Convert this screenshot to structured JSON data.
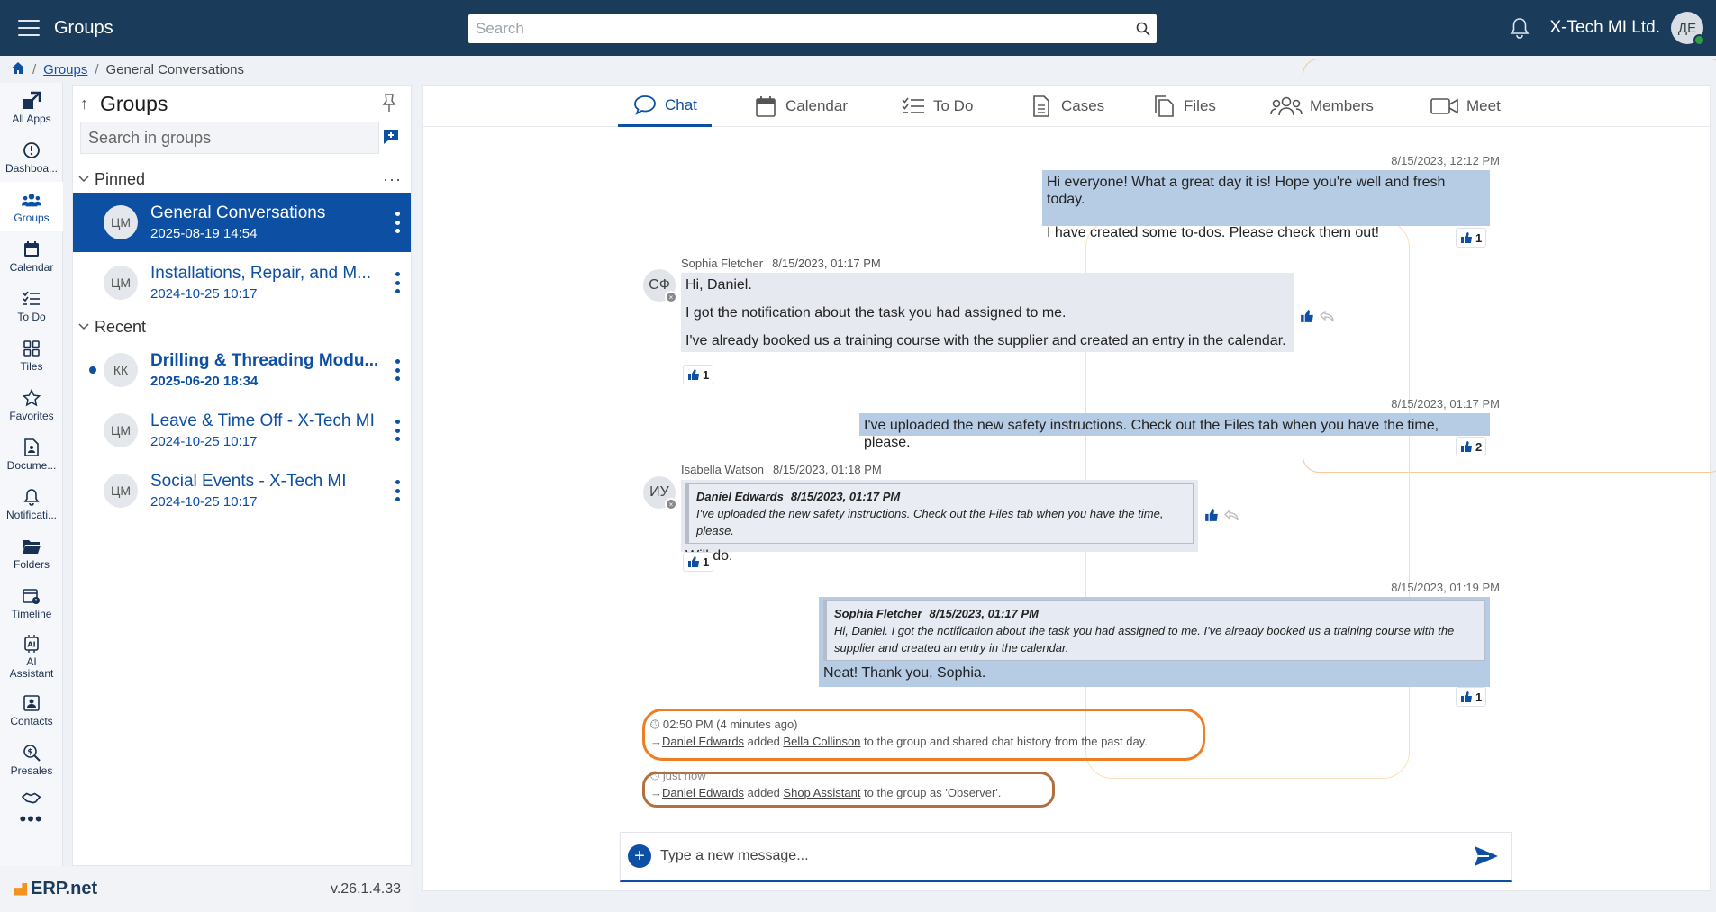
{
  "topbar": {
    "title": "Groups",
    "search_placeholder": "Search",
    "company": "X-Tech MI Ltd.",
    "avatar_initials": "ДЕ"
  },
  "breadcrumb": {
    "home": "home",
    "groups": "Groups",
    "current": "General Conversations"
  },
  "rail": [
    {
      "label": "All Apps",
      "icon": "all-apps-icon"
    },
    {
      "label": "Dashboa...",
      "icon": "dashboard-icon"
    },
    {
      "label": "Groups",
      "icon": "groups-icon"
    },
    {
      "label": "Calendar",
      "icon": "calendar-icon"
    },
    {
      "label": "To Do",
      "icon": "todo-icon"
    },
    {
      "label": "Tiles",
      "icon": "tiles-icon"
    },
    {
      "label": "Favorites",
      "icon": "star-icon"
    },
    {
      "label": "Docume...",
      "icon": "document-icon"
    },
    {
      "label": "Notificati...",
      "icon": "bell-icon"
    },
    {
      "label": "Folders",
      "icon": "folder-icon"
    },
    {
      "label": "Timeline",
      "icon": "timeline-icon"
    },
    {
      "label": "AI Assistant",
      "icon": "ai-icon"
    },
    {
      "label": "Contacts",
      "icon": "contacts-icon"
    },
    {
      "label": "Presales",
      "icon": "presales-icon"
    },
    {
      "label": "",
      "icon": "handshake-icon"
    }
  ],
  "groups_panel": {
    "title": "Groups",
    "search_placeholder": "Search in groups",
    "pinned_label": "Pinned",
    "recent_label": "Recent",
    "more": "···",
    "pinned": [
      {
        "name": "General Conversations",
        "date": "2025-08-19 14:54",
        "initials": "ЦМ"
      },
      {
        "name": "Installations, Repair, and M...",
        "date": "2024-10-25 10:17",
        "initials": "ЦМ"
      }
    ],
    "recent": [
      {
        "name": "Drilling & Threading Modu...",
        "date": "2025-06-20 18:34",
        "initials": "КК"
      },
      {
        "name": "Leave & Time Off - X-Tech MI",
        "date": "2024-10-25 10:17",
        "initials": "ЦМ"
      },
      {
        "name": "Social Events - X-Tech MI",
        "date": "2024-10-25 10:17",
        "initials": "ЦМ"
      }
    ]
  },
  "footer": {
    "logo": "ERP.net",
    "version": "v.26.1.4.33"
  },
  "tabs": [
    "Chat",
    "Calendar",
    "To Do",
    "Cases",
    "Files",
    "Members",
    "Meet"
  ],
  "messages": {
    "m1": {
      "time": "8/15/2023, 12:12 PM",
      "p1": "Hi everyone! What a great day it is! Hope you're well and fresh today.",
      "p2": "I have created some to-dos. Please check them out!",
      "reaction": "1"
    },
    "m2": {
      "sender": "Sophia Fletcher",
      "time": "8/15/2023, 01:17 PM",
      "initials": "СФ",
      "p1": "Hi, Daniel.",
      "p2": "I got the notification about the task you had assigned to me.",
      "p3": "I've already booked us a training course with the supplier and created an entry in the calendar.",
      "reaction": "1"
    },
    "m3": {
      "time": "8/15/2023, 01:17 PM",
      "p1": "I've uploaded the new safety instructions. Check out the Files tab when you have the time, please.",
      "reaction": "2"
    },
    "m4": {
      "sender": "Isabella Watson",
      "time": "8/15/2023, 01:18 PM",
      "initials": "ИУ",
      "quote_author": "Daniel Edwards",
      "quote_time": "8/15/2023, 01:17 PM",
      "quote_text": "I've uploaded the new safety instructions. Check out the Files tab when you have the time, please.",
      "text": "Will do.",
      "reaction": "1"
    },
    "m5": {
      "time": "8/15/2023, 01:19 PM",
      "quote_author": "Sophia Fletcher",
      "quote_time": "8/15/2023, 01:17 PM",
      "quote_text": "Hi, Daniel. I got the notification about the task you had assigned to me. I've already booked us a training course with the supplier and created an entry in the calendar.",
      "text": "Neat! Thank you, Sophia.",
      "reaction": "1"
    }
  },
  "system": {
    "s1": {
      "time": "02:50 PM (4 minutes ago)",
      "actor": "Daniel Edwards",
      "verb": " added ",
      "target": "Bella Collinson",
      "rest": " to the group and shared chat history from the past day."
    },
    "s2": {
      "time": "just now",
      "actor": "Daniel Edwards",
      "verb": " added ",
      "target": "Shop Assistant",
      "rest": " to the group as 'Observer'."
    }
  },
  "composer": {
    "placeholder": "Type a new message..."
  },
  "colors": {
    "brand": "#0d4fa3",
    "topbar": "#1a3b5a",
    "highlight": "#ee7d24"
  }
}
